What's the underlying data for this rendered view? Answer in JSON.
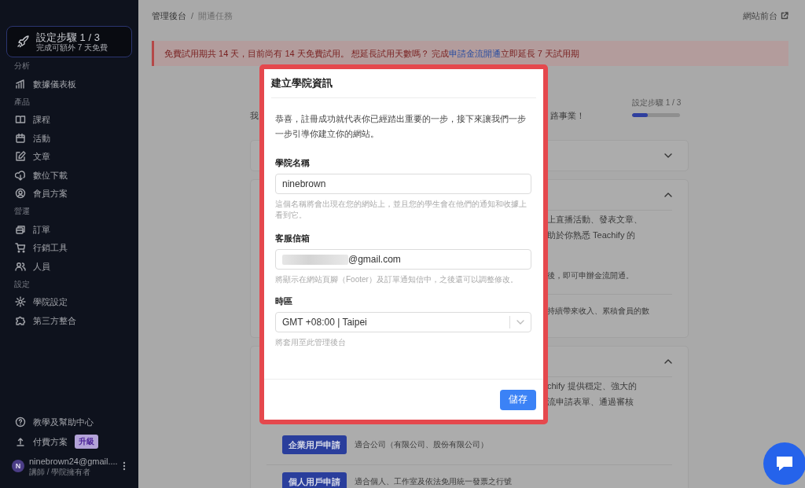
{
  "sidebar": {
    "setup_card": {
      "title": "設定步驟 1 / 3",
      "subtitle": "完成可額外 7 天免費"
    },
    "sections": [
      {
        "label": "分析",
        "items": [
          "數據儀表板"
        ]
      },
      {
        "label": "產品",
        "items": [
          "課程",
          "活動",
          "文章",
          "數位下載",
          "會員方案"
        ]
      },
      {
        "label": "營運",
        "items": [
          "訂單",
          "行銷工具",
          "人員"
        ]
      },
      {
        "label": "設定",
        "items": [
          "學院設定",
          "第三方整合"
        ]
      }
    ],
    "footer_items": [
      {
        "label": "教學及幫助中心"
      },
      {
        "label": "付費方案",
        "badge": "升級"
      }
    ],
    "user": {
      "initial": "N",
      "email": "ninebrown24@gmail....",
      "role": "講師 / 學院擁有者"
    }
  },
  "breadcrumb": [
    "管理後台",
    "開通任務"
  ],
  "breadcrumb_separator": "/",
  "site_link": "網站前台",
  "alert": {
    "before": "免費試用期共 14 天，目前尚有 14 天免費試用。 想延長試用天數嗎？ 完成",
    "link": "申請金流開通",
    "after": "立即延長 7 天試用期"
  },
  "background_page": {
    "description": "我",
    "description_tail": "路事業！",
    "progress": {
      "label": "設定步驟 1 / 3",
      "level": 0.33
    },
    "cards": [
      {
        "expanded": false
      },
      {
        "expanded": true,
        "lines": [
          {
            "text": "上直播活動、發表文章、",
            "kind": "body"
          },
          {
            "text": "助於你熟悉 Teachify 的",
            "kind": "body"
          },
          {
            "text": "後，即可申辦金流開通。",
            "kind": "note"
          },
          {
            "text": "持續帶來收入、累積會員的數",
            "kind": "note-separated"
          }
        ]
      },
      {
        "expanded": true,
        "lines": [
          {
            "text": "chify 提供穩定、強大的",
            "kind": "body"
          },
          {
            "text": "流申請表單、通過審核",
            "kind": "body"
          }
        ],
        "actions": [
          {
            "button": "企業用戶申請",
            "note": "適合公司（有限公司、股份有限公司）"
          },
          {
            "button": "個人用戶申請",
            "note": "適合個人、工作室及依法免用統一發票之行號"
          }
        ]
      }
    ]
  },
  "modal": {
    "title": "建立學院資訊",
    "intro": "恭喜，註冊成功就代表你已經踏出重要的一步，接下來讓我們一步一步引導你建立你的網站。",
    "fields": [
      {
        "kind": "text",
        "label": "學院名稱",
        "value": "ninebrown",
        "hint": "這個名稱將會出現在您的網站上，並且您的學生會在他們的通知和收據上看到它。"
      },
      {
        "kind": "redacted",
        "label": "客服信箱",
        "value": "@gmail.com",
        "hint": "將顯示在網站頁腳（Footer）及訂單通知信中，之後還可以調整修改。"
      },
      {
        "kind": "select",
        "label": "時區",
        "value": "GMT +08:00 | Taipei",
        "hint": "將套用至此管理後台"
      }
    ],
    "save_button": "儲存"
  }
}
